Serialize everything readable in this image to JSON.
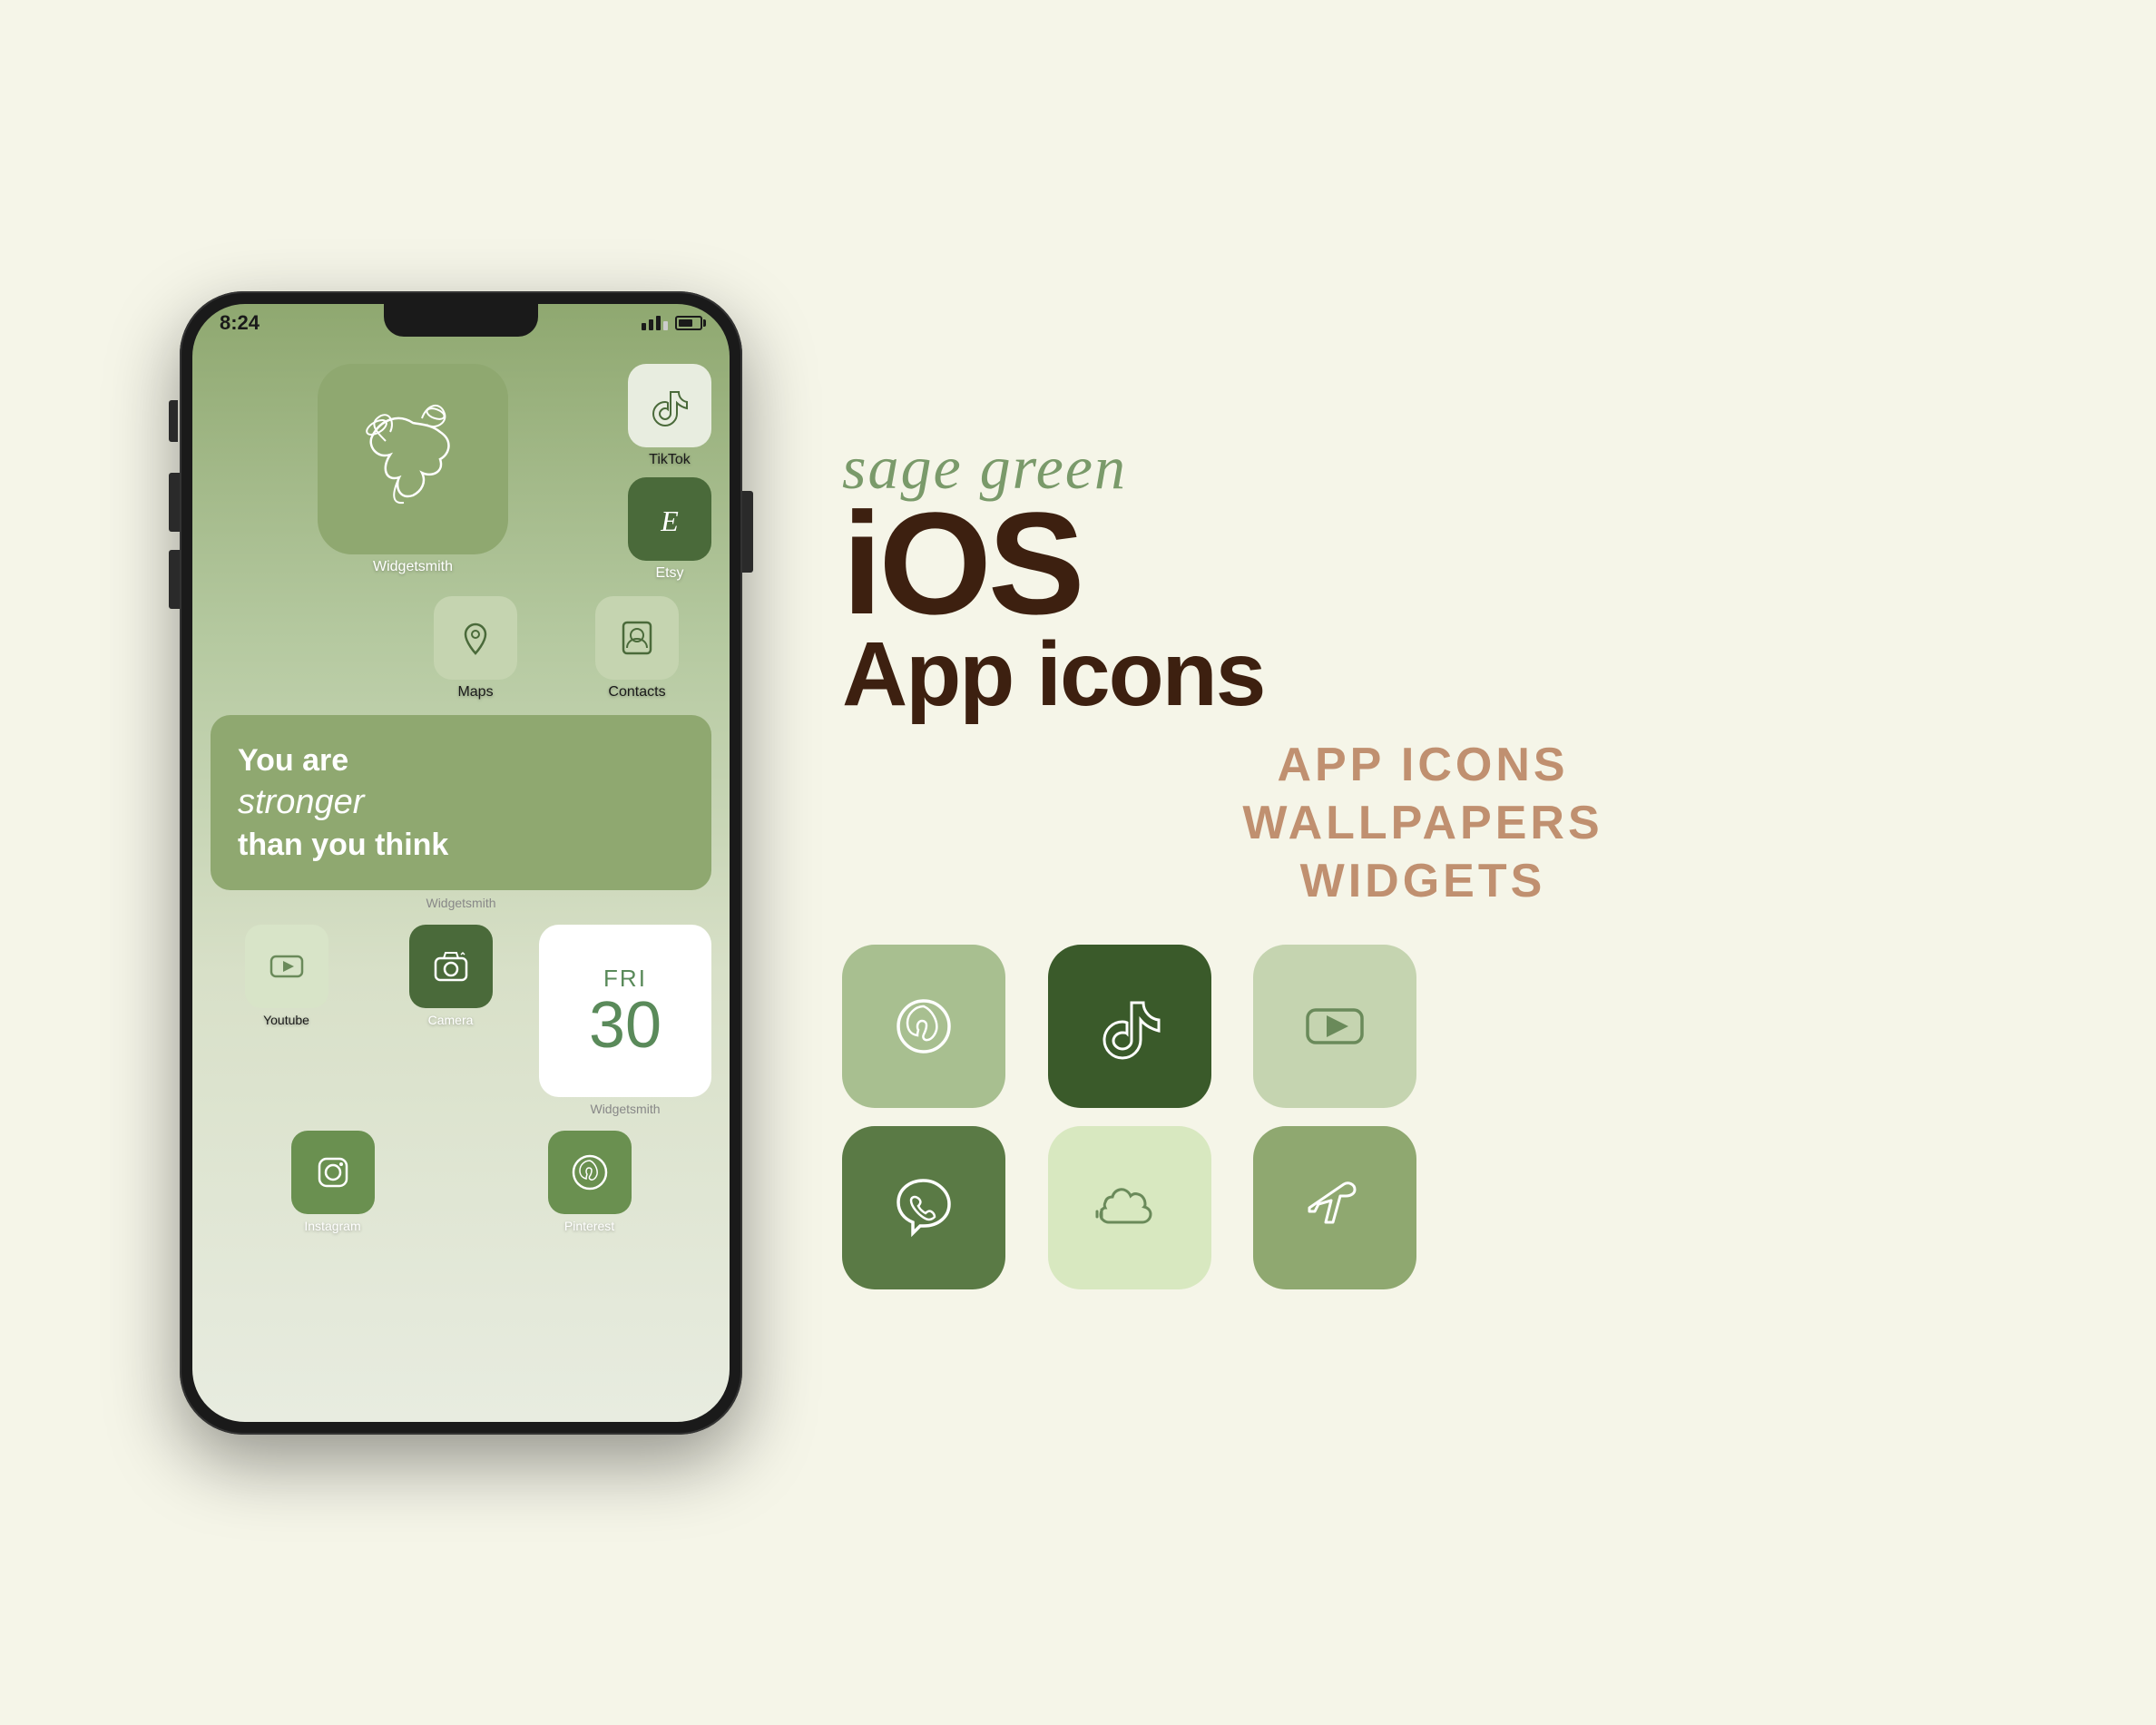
{
  "background_color": "#f5f5e8",
  "phone": {
    "status_time": "8:24",
    "screen_bg_top": "#8fa870",
    "screen_bg_bottom": "#e8ece0"
  },
  "app_icons": {
    "widgetsmith_large": {
      "label": "Widgetsmith",
      "bg": "#8fa870"
    },
    "tiktok": {
      "label": "TikTok",
      "bg": "#e8ede0"
    },
    "etsy": {
      "label": "Etsy",
      "bg": "#4a6a3a"
    },
    "maps": {
      "label": "Maps",
      "bg": "#c5d4b0"
    },
    "contacts": {
      "label": "Contacts",
      "bg": "#c5d4b0"
    },
    "youtube": {
      "label": "Youtube",
      "bg": "#d8e4c8"
    },
    "camera": {
      "label": "Camera",
      "bg": "#4a6a3a"
    },
    "instagram": {
      "label": "Instagram",
      "bg": "#6a9050"
    },
    "pinterest": {
      "label": "Pinterest",
      "bg": "#6a9050"
    },
    "widgetsmith_attr": "Widgetsmith"
  },
  "widget": {
    "line1": "You are",
    "line2": "stronger",
    "line3": "than you think",
    "attribution": "Widgetsmith",
    "bg": "#8fa870"
  },
  "calendar": {
    "day": "FRI",
    "num": "30",
    "attribution": "Widgetsmith"
  },
  "right_side": {
    "sage_green": "sage green",
    "ios": "iOS",
    "app_icons": "App icons",
    "feature1": "APP ICONS",
    "feature2": "WALLPAPERS",
    "feature3": "WIDGETS"
  },
  "sample_icons": [
    {
      "name": "pinterest-sample",
      "bg": "#a8bf90",
      "icon": "pinterest"
    },
    {
      "name": "tiktok-sample",
      "bg": "#4a6a3a",
      "icon": "tiktok"
    },
    {
      "name": "youtube-sample",
      "bg": "#c5d4b0",
      "icon": "youtube"
    },
    {
      "name": "viber-sample",
      "bg": "#6a9050",
      "icon": "viber"
    },
    {
      "name": "soundcloud-sample",
      "bg": "#d8e4c8",
      "icon": "soundcloud"
    },
    {
      "name": "plane-sample",
      "bg": "#8fa870",
      "icon": "plane"
    }
  ],
  "colors": {
    "sage_light": "#c5d4b0",
    "sage_mid": "#8fa870",
    "sage_dark": "#4a6a3a",
    "sage_darker": "#3a5a2a",
    "brown_dark": "#3d2010",
    "salmon": "#c09070",
    "script_green": "#7a9a6a"
  }
}
